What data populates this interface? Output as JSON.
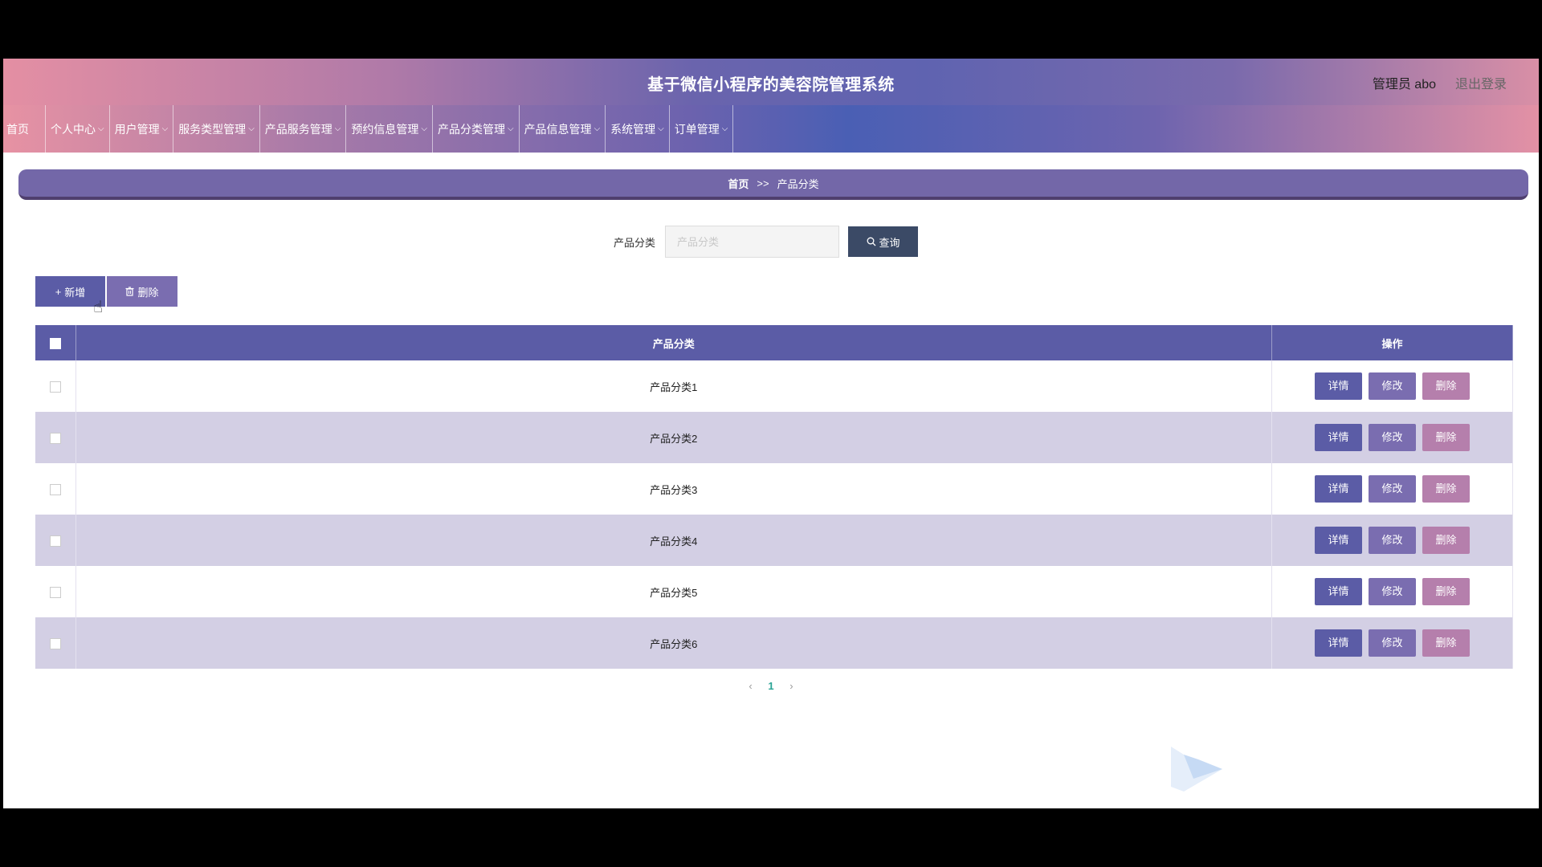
{
  "header": {
    "title": "基于微信小程序的美容院管理系统",
    "user": "管理员 abo",
    "logout": "退出登录"
  },
  "nav": [
    {
      "label": "首页",
      "dropdown": false
    },
    {
      "label": "个人中心",
      "dropdown": true
    },
    {
      "label": "用户管理",
      "dropdown": true
    },
    {
      "label": "服务类型管理",
      "dropdown": true
    },
    {
      "label": "产品服务管理",
      "dropdown": true
    },
    {
      "label": "预约信息管理",
      "dropdown": true
    },
    {
      "label": "产品分类管理",
      "dropdown": true
    },
    {
      "label": "产品信息管理",
      "dropdown": true
    },
    {
      "label": "系统管理",
      "dropdown": true
    },
    {
      "label": "订单管理",
      "dropdown": true
    }
  ],
  "breadcrumb": {
    "home": "首页",
    "separator": ">>",
    "current": "产品分类"
  },
  "search": {
    "label": "产品分类",
    "placeholder": "产品分类",
    "button": "查询"
  },
  "actions": {
    "add": "新增",
    "delete": "删除"
  },
  "table": {
    "headers": {
      "name": "产品分类",
      "ops": "操作"
    },
    "rows": [
      "产品分类1",
      "产品分类2",
      "产品分类3",
      "产品分类4",
      "产品分类5",
      "产品分类6"
    ],
    "row_actions": {
      "detail": "详情",
      "edit": "修改",
      "delete": "删除"
    }
  },
  "pagination": {
    "current": "1"
  },
  "colors": {
    "primary": "#5b5ca6",
    "secondary": "#7a6db0",
    "danger": "#b57fac",
    "query": "#3b4a66",
    "row_alt": "#d3cfe4"
  }
}
